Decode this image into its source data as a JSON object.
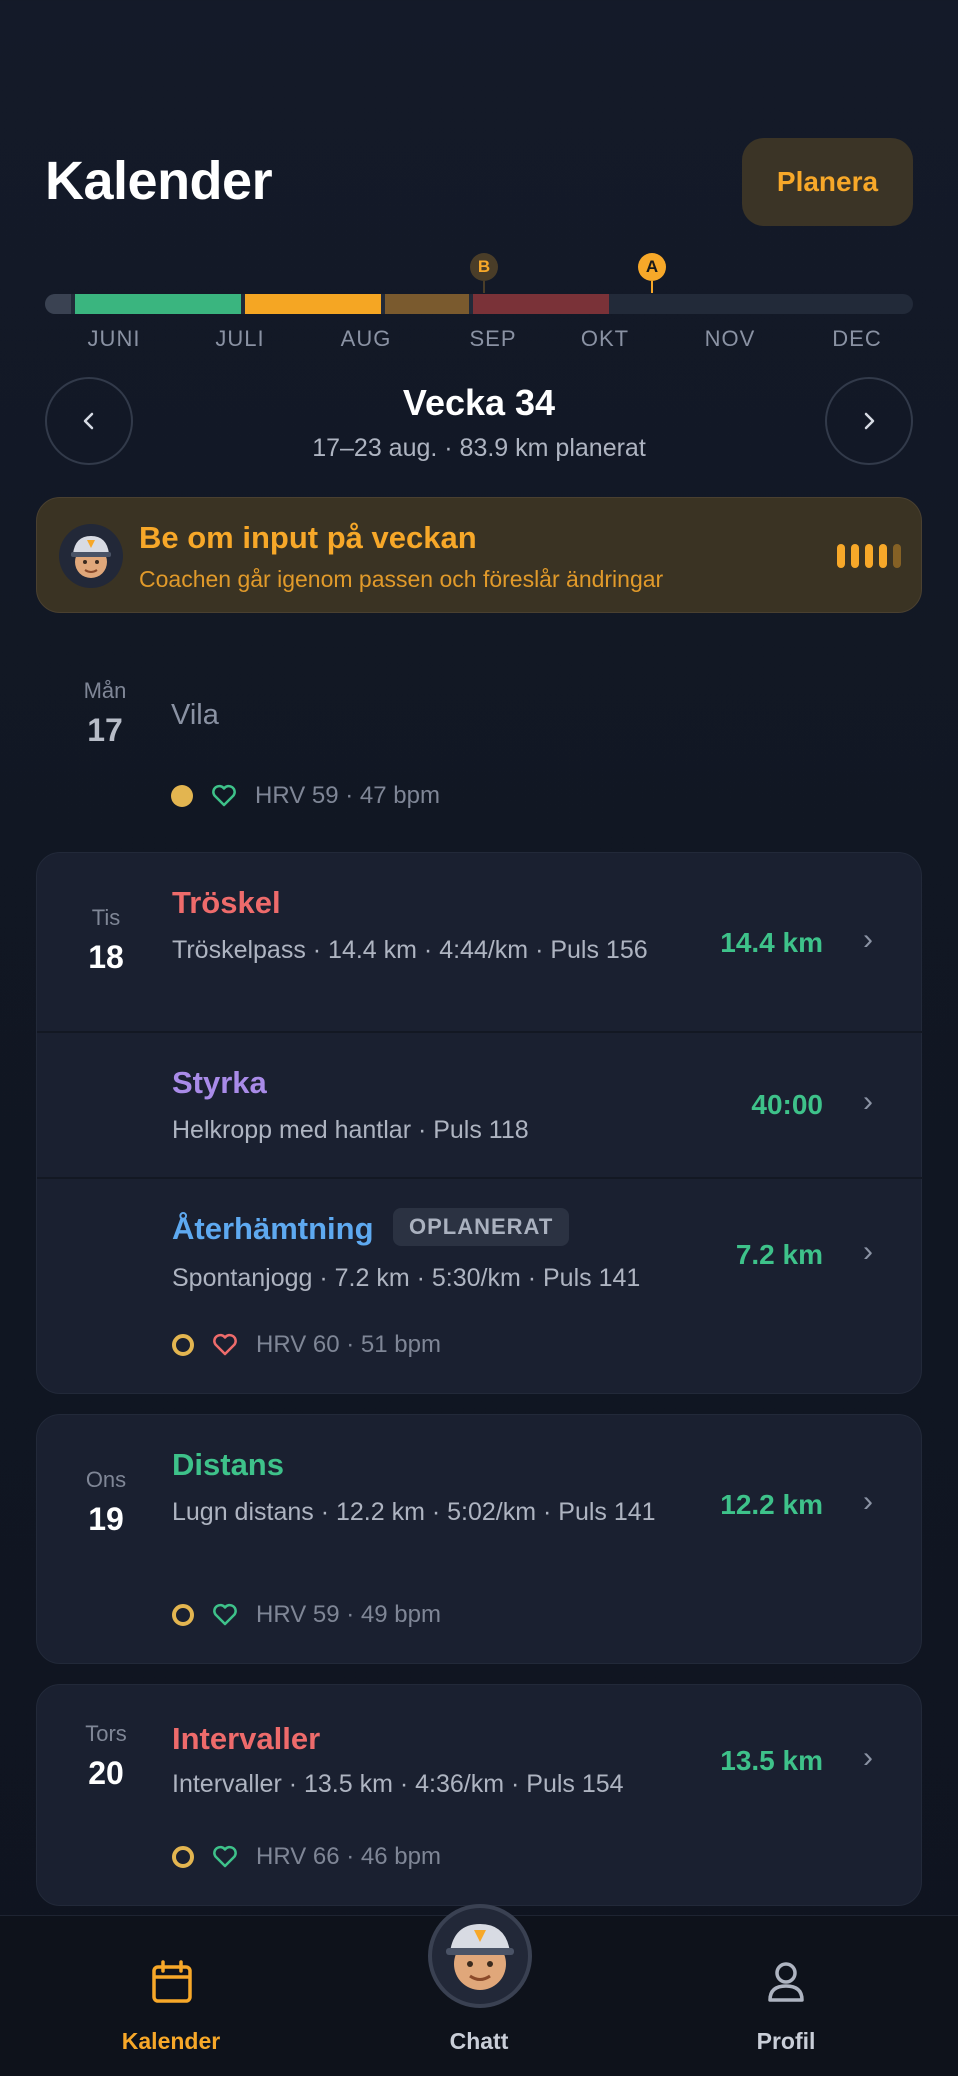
{
  "header": {
    "title": "Kalender",
    "plan_button": "Planera"
  },
  "timeline": {
    "months": [
      "JUNI",
      "JULI",
      "AUG",
      "SEP",
      "OKT",
      "NOV",
      "DEC"
    ],
    "markers": [
      {
        "label": "B"
      },
      {
        "label": "A"
      }
    ],
    "colors": {
      "green": "#3ab57f",
      "yellow": "#f5a623",
      "brown": "#7a5a2e",
      "red": "#7a3238",
      "accent": "#f7a829"
    }
  },
  "week": {
    "title": "Vecka 34",
    "subtitle": "17–23 aug. · 83.9 km planerat",
    "prev_icon": "chevron-left-icon",
    "next_icon": "chevron-right-icon"
  },
  "coach": {
    "title": "Be om input på veckan",
    "subtitle": "Coachen går igenom passen och föreslår ändringar"
  },
  "days": {
    "mon": {
      "dow": "Mån",
      "date": "17",
      "rest": "Vila",
      "stats": "HRV 59 · 47 bpm"
    },
    "tue": {
      "dow": "Tis",
      "date": "18",
      "w1": {
        "title": "Tröskel",
        "desc": "Tröskelpass · 14.4 km · 4:44/km · Puls 156",
        "value": "14.4 km"
      },
      "w2": {
        "title": "Styrka",
        "desc": "Helkropp med hantlar · Puls 118",
        "value": "40:00"
      },
      "w3": {
        "title": "Återhämtning",
        "badge": "OPLANERAT",
        "desc": "Spontanjogg · 7.2 km · 5:30/km · Puls 141",
        "value": "7.2 km"
      },
      "stats": "HRV 60 · 51 bpm"
    },
    "wed": {
      "dow": "Ons",
      "date": "19",
      "title": "Distans",
      "desc": "Lugn distans · 12.2 km · 5:02/km · Puls 141",
      "value": "12.2 km",
      "stats": "HRV 59 · 49 bpm"
    },
    "thu": {
      "dow": "Tors",
      "date": "20",
      "title": "Intervaller",
      "desc": "Intervaller · 13.5 km · 4:36/km · Puls 154",
      "value": "13.5 km",
      "stats": "HRV 66 · 46 bpm"
    }
  },
  "tabs": {
    "calendar": "Kalender",
    "chat": "Chatt",
    "profile": "Profil"
  }
}
